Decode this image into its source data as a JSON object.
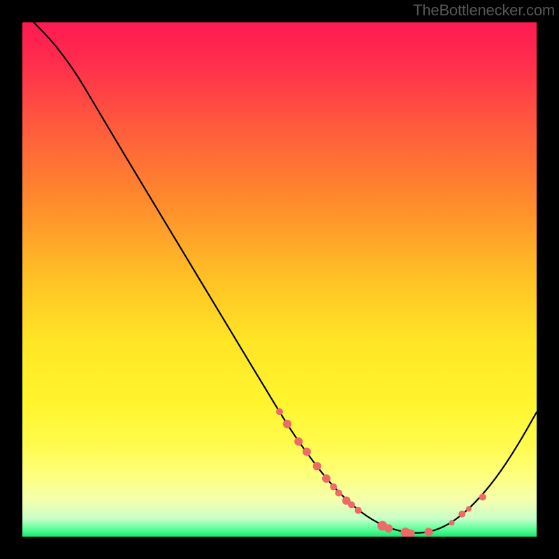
{
  "attribution": "TheBottlenecker.com",
  "chart_data": {
    "type": "line",
    "title": "",
    "xlabel": "",
    "ylabel": "",
    "xlim": [
      0,
      1
    ],
    "ylim": [
      0,
      1
    ],
    "gradient_stops": [
      {
        "offset": 0.0,
        "color": "#ff1a52"
      },
      {
        "offset": 0.08,
        "color": "#ff2e4c"
      },
      {
        "offset": 0.2,
        "color": "#ff5a3e"
      },
      {
        "offset": 0.35,
        "color": "#ff8b2c"
      },
      {
        "offset": 0.5,
        "color": "#ffc225"
      },
      {
        "offset": 0.62,
        "color": "#ffe526"
      },
      {
        "offset": 0.74,
        "color": "#fff52e"
      },
      {
        "offset": 0.82,
        "color": "#fffb4d"
      },
      {
        "offset": 0.88,
        "color": "#feff7c"
      },
      {
        "offset": 0.93,
        "color": "#f4ffae"
      },
      {
        "offset": 0.965,
        "color": "#c8ffc8"
      },
      {
        "offset": 0.985,
        "color": "#5dff9a"
      },
      {
        "offset": 1.0,
        "color": "#17e876"
      }
    ],
    "curve": [
      {
        "x": 0.022,
        "y": 1.0
      },
      {
        "x": 0.052,
        "y": 0.97
      },
      {
        "x": 0.08,
        "y": 0.935
      },
      {
        "x": 0.108,
        "y": 0.895
      },
      {
        "x": 0.136,
        "y": 0.848
      },
      {
        "x": 0.175,
        "y": 0.782
      },
      {
        "x": 0.22,
        "y": 0.707
      },
      {
        "x": 0.27,
        "y": 0.624
      },
      {
        "x": 0.32,
        "y": 0.541
      },
      {
        "x": 0.37,
        "y": 0.458
      },
      {
        "x": 0.42,
        "y": 0.375
      },
      {
        "x": 0.47,
        "y": 0.292
      },
      {
        "x": 0.52,
        "y": 0.21
      },
      {
        "x": 0.56,
        "y": 0.153
      },
      {
        "x": 0.6,
        "y": 0.102
      },
      {
        "x": 0.64,
        "y": 0.062
      },
      {
        "x": 0.68,
        "y": 0.032
      },
      {
        "x": 0.72,
        "y": 0.014
      },
      {
        "x": 0.76,
        "y": 0.006
      },
      {
        "x": 0.8,
        "y": 0.01
      },
      {
        "x": 0.84,
        "y": 0.03
      },
      {
        "x": 0.88,
        "y": 0.065
      },
      {
        "x": 0.92,
        "y": 0.112
      },
      {
        "x": 0.96,
        "y": 0.172
      },
      {
        "x": 1.0,
        "y": 0.242
      }
    ],
    "markers": [
      {
        "x": 0.5,
        "y": 0.243,
        "r": 5
      },
      {
        "x": 0.515,
        "y": 0.219,
        "r": 6
      },
      {
        "x": 0.515,
        "y": 0.219,
        "r": 6
      },
      {
        "x": 0.537,
        "y": 0.185,
        "r": 6
      },
      {
        "x": 0.553,
        "y": 0.165,
        "r": 6
      },
      {
        "x": 0.573,
        "y": 0.137,
        "r": 6
      },
      {
        "x": 0.591,
        "y": 0.113,
        "r": 6
      },
      {
        "x": 0.605,
        "y": 0.097,
        "r": 5
      },
      {
        "x": 0.615,
        "y": 0.085,
        "r": 5
      },
      {
        "x": 0.63,
        "y": 0.07,
        "r": 6
      },
      {
        "x": 0.64,
        "y": 0.062,
        "r": 5
      },
      {
        "x": 0.653,
        "y": 0.051,
        "r": 5
      },
      {
        "x": 0.7,
        "y": 0.021,
        "r": 7
      },
      {
        "x": 0.712,
        "y": 0.016,
        "r": 6
      },
      {
        "x": 0.745,
        "y": 0.008,
        "r": 7
      },
      {
        "x": 0.755,
        "y": 0.006,
        "r": 6
      },
      {
        "x": 0.79,
        "y": 0.009,
        "r": 6
      },
      {
        "x": 0.835,
        "y": 0.027,
        "r": 4
      },
      {
        "x": 0.855,
        "y": 0.044,
        "r": 5
      },
      {
        "x": 0.868,
        "y": 0.054,
        "r": 4
      },
      {
        "x": 0.895,
        "y": 0.077,
        "r": 5
      }
    ],
    "marker_color": "#ed6a66",
    "curve_color": "#000000",
    "curve_width": 2.2
  }
}
